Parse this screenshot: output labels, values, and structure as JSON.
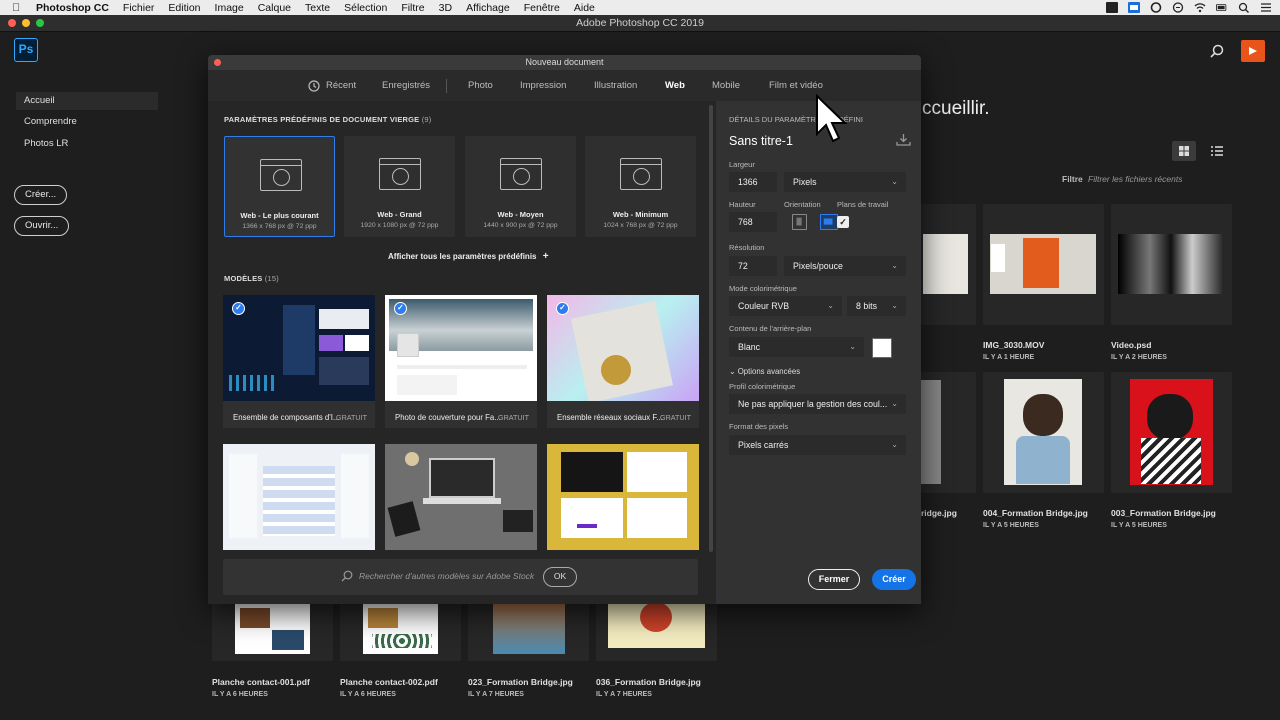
{
  "menubar": {
    "app": "Photoshop CC",
    "items": [
      "Fichier",
      "Edition",
      "Image",
      "Calque",
      "Texte",
      "Sélection",
      "Filtre",
      "3D",
      "Affichage",
      "Fenêtre",
      "Aide"
    ]
  },
  "window": {
    "title": "Adobe Photoshop CC 2019"
  },
  "home": {
    "logo": "Ps",
    "sidebar": [
      {
        "label": "Accueil"
      },
      {
        "label": "Comprendre"
      },
      {
        "label": "Photos LR"
      }
    ],
    "create_label": "Créer...",
    "open_label": "Ouvrir...",
    "welcome_fragment": "ccueillir.",
    "filter_label": "Filtre",
    "filter_placeholder": "Filtrer les fichiers récents",
    "files": [
      {
        "name": "IMG_3030.MOV",
        "date": "IL Y A 1 HEURE"
      },
      {
        "name": "Video.psd",
        "date": "IL Y A 2 HEURES"
      },
      {
        "name": "ridge.jpg",
        "date": ""
      },
      {
        "name": "004_Formation Bridge.jpg",
        "date": "IL Y A 5 HEURES"
      },
      {
        "name": "003_Formation Bridge.jpg",
        "date": "IL Y A 5 HEURES"
      },
      {
        "name": "Planche contact-001.pdf",
        "date": "IL Y A 6 HEURES"
      },
      {
        "name": "Planche contact-002.pdf",
        "date": "IL Y A 6 HEURES"
      },
      {
        "name": "023_Formation Bridge.jpg",
        "date": "IL Y A 7 HEURES"
      },
      {
        "name": "036_Formation Bridge.jpg",
        "date": "IL Y A 7 HEURES"
      }
    ]
  },
  "dialog": {
    "title": "Nouveau document",
    "tabs": [
      {
        "label": "Récent"
      },
      {
        "label": "Enregistrés"
      },
      {
        "label": "Photo"
      },
      {
        "label": "Impression"
      },
      {
        "label": "Illustration"
      },
      {
        "label": "Web"
      },
      {
        "label": "Mobile"
      },
      {
        "label": "Film et vidéo"
      }
    ],
    "active_tab": "Web",
    "presets_title": "PARAMÈTRES PRÉDÉFINIS DE DOCUMENT VIERGE",
    "presets_count": "(9)",
    "presets": [
      {
        "name": "Web - Le plus courant",
        "size": "1366 x 768 px @ 72 ppp"
      },
      {
        "name": "Web - Grand",
        "size": "1920 x 1080 px @ 72 ppp"
      },
      {
        "name": "Web - Moyen",
        "size": "1440 x 900 px @ 72 ppp"
      },
      {
        "name": "Web - Minimum",
        "size": "1024 x 768 px @ 72 ppp"
      }
    ],
    "show_all": "Afficher tous les paramètres prédéfinis",
    "templates_title": "MODÈLES",
    "templates_count": "(15)",
    "templates": [
      {
        "name": "Ensemble de composants d'I...",
        "badge": "GRATUIT"
      },
      {
        "name": "Photo de couverture pour Fa...",
        "badge": "GRATUIT"
      },
      {
        "name": "Ensemble réseaux sociaux F...",
        "badge": "GRATUIT"
      }
    ],
    "stock_placeholder": "Rechercher d'autres modèles sur Adobe Stock",
    "ok_label": "OK",
    "details": {
      "section_title": "DÉTAILS DU PARAMÈTRE PRÉDÉFINI",
      "doc_name": "Sans titre-1",
      "width_label": "Largeur",
      "width": "1366",
      "width_unit": "Pixels",
      "height_label": "Hauteur",
      "height": "768",
      "orientation_label": "Orientation",
      "artboards_label": "Plans de travail",
      "resolution_label": "Résolution",
      "resolution": "72",
      "resolution_unit": "Pixels/pouce",
      "color_mode_label": "Mode colorimétrique",
      "color_mode": "Couleur RVB",
      "bit_depth": "8 bits",
      "bg_label": "Contenu de l'arrière-plan",
      "bg_value": "Blanc",
      "advanced_label": "Options avancées",
      "profile_label": "Profil colorimétrique",
      "profile_value": "Ne pas appliquer la gestion des coul...",
      "pixel_format_label": "Format des pixels",
      "pixel_format": "Pixels carrés",
      "close_label": "Fermer",
      "create_label": "Créer"
    }
  },
  "colors": {
    "accent": "#1473e6",
    "selection": "#2d7cf0",
    "share": "#e8541a",
    "ps_blue": "#31a8ff"
  }
}
